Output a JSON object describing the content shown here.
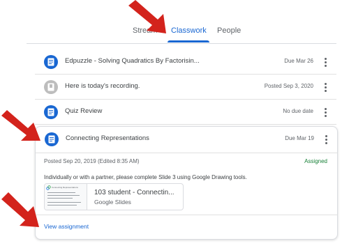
{
  "tabs": [
    {
      "label": "Stream"
    },
    {
      "label": "Classwork",
      "active": true
    },
    {
      "label": "People"
    }
  ],
  "items": [
    {
      "title": "Edpuzzle - Solving Quadratics By Factorisin...",
      "date": "Due Mar 26",
      "icon": "assignment-icon"
    },
    {
      "title": "Here is today's recording.",
      "date": "Posted Sep 3, 2020",
      "icon": "material-icon"
    },
    {
      "title": "Quiz Review",
      "date": "No due date",
      "icon": "assignment-icon"
    }
  ],
  "expanded": {
    "title": "Connecting Representations",
    "date": "Due Mar 19",
    "posted": "Posted Sep 20, 2019 (Edited 8:35 AM)",
    "status": "Assigned",
    "instructions": "Individually or with a partner, please complete Slide 3 using Google Drawing tools.",
    "attachment": {
      "title": "103 student - Connectin...",
      "subtitle": "Google Slides",
      "thumb_title": "Connecting Representations"
    },
    "view_label": "View assignment"
  },
  "colors": {
    "accent": "#1967d2",
    "assigned": "#188038",
    "annotation_arrow": "#d3231c"
  }
}
